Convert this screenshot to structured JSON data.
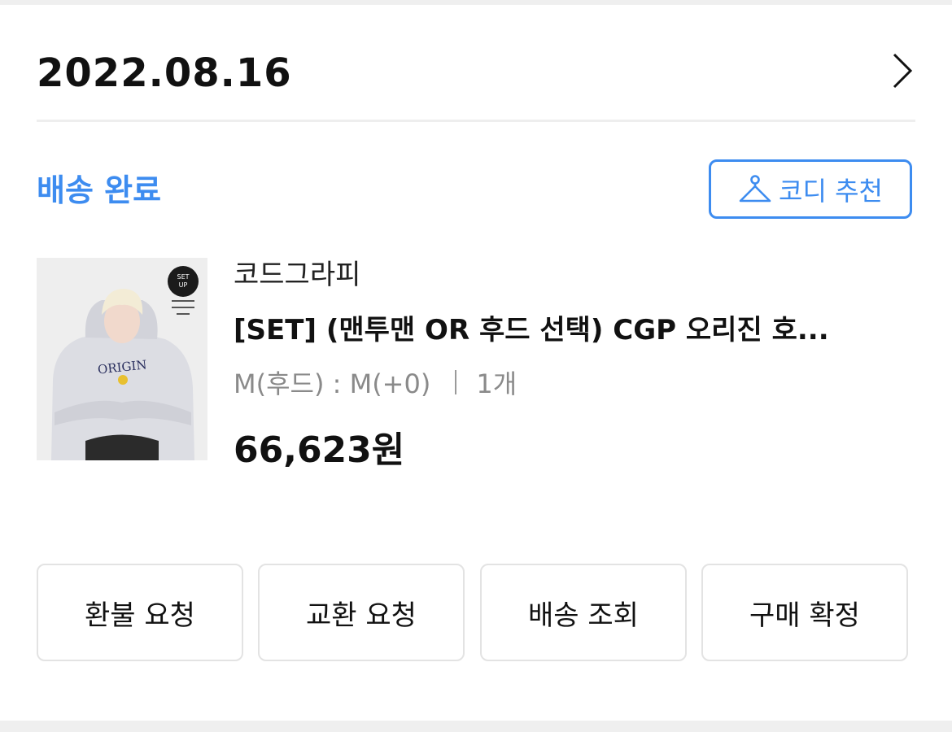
{
  "order": {
    "date": "2022.08.16",
    "status": "배송 완료",
    "codi_button": {
      "label": "코디 추천",
      "icon": "hanger-icon"
    }
  },
  "product": {
    "brand": "코드그라피",
    "name": "[SET] (맨투맨 OR 후드 선택) CGP 오리진 호...",
    "option": "M(후드) : M(+0)",
    "quantity": "1개",
    "price": "66,623원",
    "thumbnail": {
      "badge_lines": [
        "SET",
        "UP"
      ],
      "shirt_text": "ORIGIN"
    }
  },
  "actions": [
    {
      "label": "환불 요청"
    },
    {
      "label": "교환 요청"
    },
    {
      "label": "배송 조회"
    },
    {
      "label": "구매 확정"
    }
  ],
  "colors": {
    "accent": "#3d8cf0",
    "text": "#111111",
    "muted": "#8a8a8a",
    "border": "#e3e3e3",
    "band": "#efefef"
  }
}
